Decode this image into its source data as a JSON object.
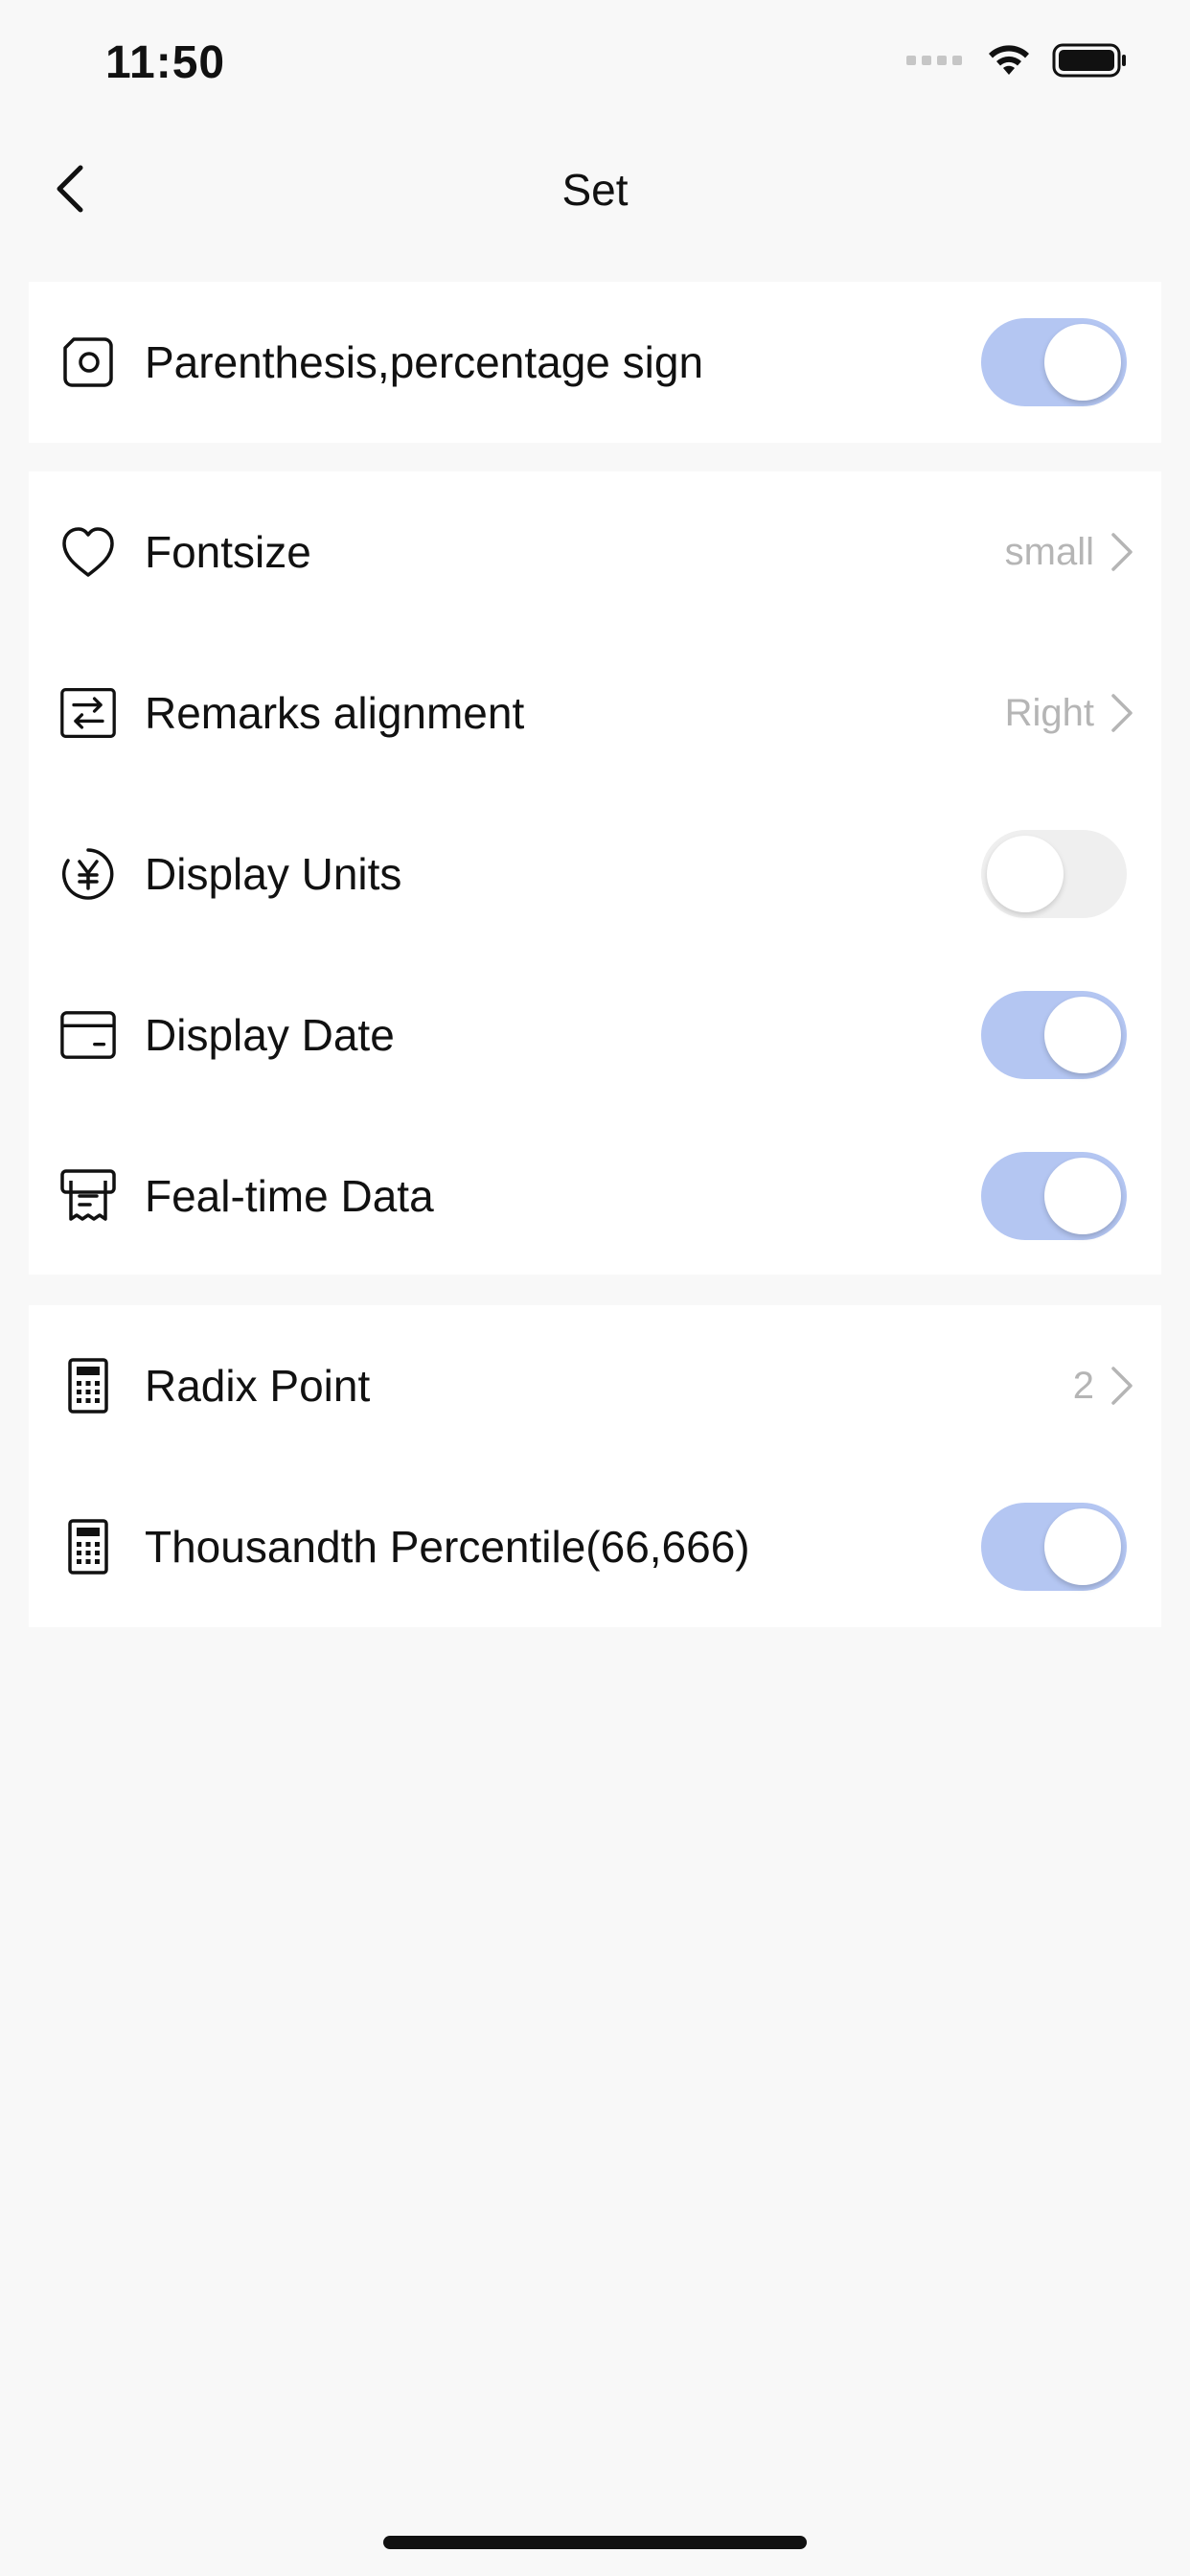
{
  "status_bar": {
    "time": "11:50",
    "icons": [
      "signal-dots-icon",
      "wifi-icon",
      "battery-icon"
    ]
  },
  "nav": {
    "title": "Set",
    "back_icon": "chevron-left-icon"
  },
  "groups": [
    {
      "rows": [
        {
          "label": "Parenthesis,percentage sign",
          "icon": "camera-square-icon",
          "type": "toggle",
          "on": true
        }
      ]
    },
    {
      "rows": [
        {
          "label": "Fontsize",
          "icon": "heart-icon",
          "type": "value",
          "value": "small"
        },
        {
          "label": "Remarks alignment",
          "icon": "swap-arrows-icon",
          "type": "value",
          "value": "Right"
        },
        {
          "label": "Display Units",
          "icon": "yen-circle-icon",
          "type": "toggle",
          "on": false
        },
        {
          "label": "Display Date",
          "icon": "card-icon",
          "type": "toggle",
          "on": true
        },
        {
          "label": "Feal-time Data",
          "icon": "receipt-icon",
          "type": "toggle",
          "on": true
        }
      ]
    },
    {
      "rows": [
        {
          "label": "Radix Point",
          "icon": "calculator-icon",
          "type": "value",
          "value": "2"
        },
        {
          "label": "Thousandth Percentile(66,666)",
          "icon": "calculator-icon",
          "type": "toggle",
          "on": true
        }
      ]
    }
  ],
  "colors": {
    "background": "#f8f8f8",
    "card": "#ffffff",
    "toggle_on": "#b4c6f2",
    "toggle_off": "#efefef",
    "value_text": "#b5b5b5"
  }
}
